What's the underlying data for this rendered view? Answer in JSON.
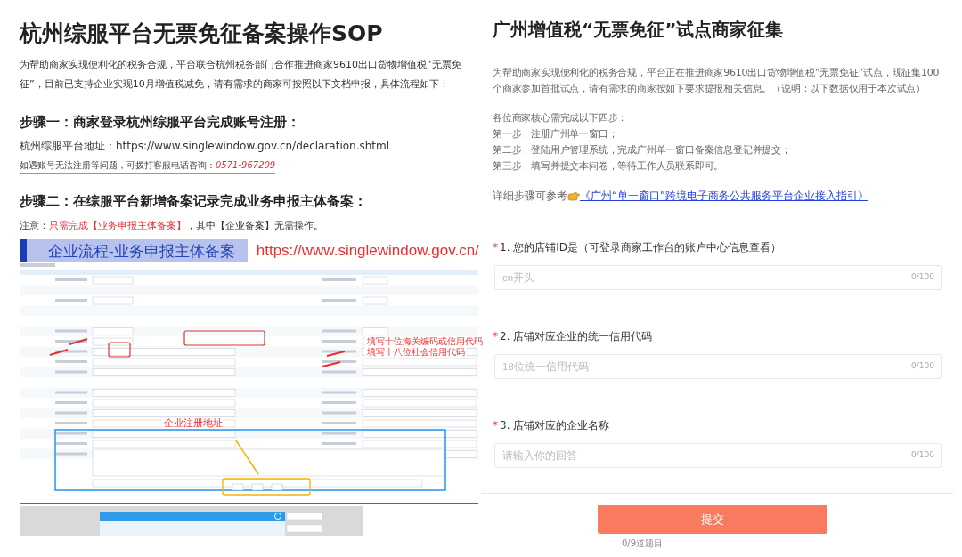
{
  "left_article": {
    "title": "杭州综服平台无票免征备案操作SOP",
    "intro": "为帮助商家实现便利化的税务合规，平台联合杭州税务部门合作推进商家9610出口货物增值税“无票免征”，目前已支持企业实现10月增值税减免，请有需求的商家可按照以下文档申报，具体流程如下：",
    "step1": {
      "heading": "步骤一：商家登录杭州综服平台完成账号注册：",
      "address": "杭州综服平台地址：https://www.singlewindow.gov.cn/declaration.shtml",
      "help_text": "如遇账号无法注册等问题，可拨打客服电话咨询：",
      "help_phone": "0571-967209"
    },
    "step2": {
      "heading": "步骤二：在综服平台新增备案记录完成业务申报主体备案：",
      "note_label": "注意：",
      "note_highlight": "只需完成【业务申报主体备案】",
      "note_rest": "，其中【企业备案】无需操作。"
    },
    "screenshot": {
      "banner_title": "企业流程-业务申报主体备案",
      "banner_url": "https://www.singlewindow.gov.cn/",
      "annotations": [
        {
          "kind": "right",
          "text": "填写十位海关编码或信用代码"
        },
        {
          "kind": "right",
          "text": "填写十八位社会信用代码"
        },
        {
          "kind": "left",
          "text": "企业注册地址"
        }
      ]
    }
  },
  "right_form": {
    "title": "广州增值税“无票免征”试点商家征集",
    "intro": "为帮助商家实现便利化的税务合规，平台正在推进商家9610出口货物增值税“无票免征”试点，现征集100个商家参加首批试点，请有需求的商家按如下要求提报相关信息。（说明：以下数据仅用于本次试点）",
    "steps_intro": "各位商家核心需完成以下四步：",
    "steps": [
      "第一步：注册广州单一窗口；",
      "第二步：登陆用户管理系统，完成广州单一窗口备案信息登记并提交；",
      "第三步：填写并提交本问卷，等待工作人员联系即可。"
    ],
    "guide_label": "详细步骤可参考",
    "guide_link": "《广州“单一窗口”跨境电子商务公共服务平台企业接入指引》",
    "questions": [
      {
        "required": true,
        "required_mark": "*",
        "label": "1. 您的店铺ID是（可登录商家工作台的账户中心信息查看）",
        "placeholder": "cn开头",
        "counter": "0/100"
      },
      {
        "required": true,
        "required_mark": "*",
        "label": "2. 店铺对应企业的统一信用代码",
        "placeholder": "18位统一信用代码",
        "counter": "0/100"
      },
      {
        "required": true,
        "required_mark": "*",
        "label": "3. 店铺对应的企业名称",
        "placeholder": "请输入你的回答",
        "counter": "0/100"
      }
    ],
    "submit": "提交",
    "progress": "0/9道题目"
  }
}
